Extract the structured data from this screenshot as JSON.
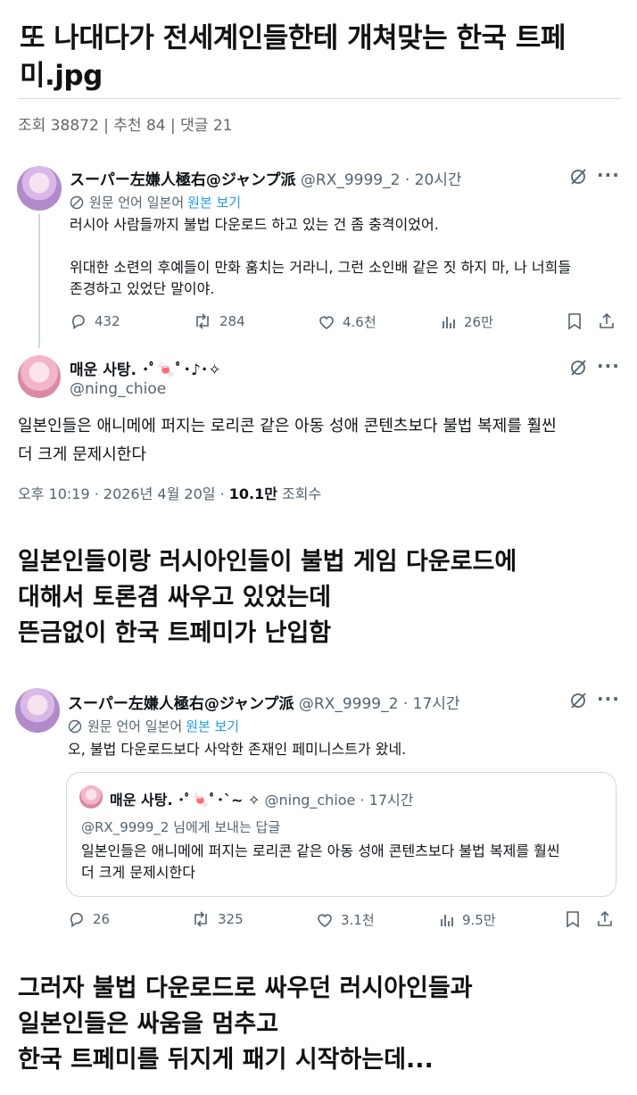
{
  "post": {
    "title": "또 나대다가 전세계인들한테 개쳐맞는 한국 트페미.jpg",
    "meta": "조회 38872 | 추천 84 | 댓글 21"
  },
  "tweet1": {
    "name": "スーパー左嫌人極右@ジャンプ派",
    "handle_time": "@RX_9999_2 · 20시간",
    "translate_label": "원문 언어 일본어",
    "translate_link": "원본 보기",
    "text": "러시아 사람들까지 불법 다운로드 하고 있는 건 좀 충격이었어.\n\n위대한 소련의 후예들이 만화 훔치는 거라니, 그런 소인배 같은 짓 하지 마, 나 너희들\n존경하고 있었단 말이야.",
    "replies": "432",
    "reposts": "284",
    "likes": "4.6천",
    "views": "26만"
  },
  "tweet2": {
    "name": "매운 사탕. ･ﾟ🍬ﾟ･♪･✧",
    "handle": "@ning_chioe",
    "text": "일본인들은 애니메에 퍼지는 로리콘 같은 아동 성애 콘텐츠보다 불법 복제를 훨씬\n더 크게 문제시한다",
    "time": "오후 10:19 · 2026년 4월 20일 · ",
    "views_count": "10.1만",
    "views_label": " 조회수"
  },
  "caption1": "일본인들이랑 러시아인들이 불법 게임 다운로드에\n대해서 토론겸 싸우고 있었는데\n뜬금없이 한국 트페미가 난입함",
  "tweet3": {
    "name": "スーパー左嫌人極右@ジャンプ派",
    "handle_time": "@RX_9999_2 · 17시간",
    "translate_label": "원문 언어 일본어",
    "translate_link": "원본 보기",
    "text": "오, 불법 다운로드보다 사악한 존재인 페미니스트가 왔네.",
    "quote": {
      "name": "매운 사탕. ･ﾟ🍬ﾟ･`~ ✧",
      "handle_time": "@ning_chioe · 17시간",
      "reply_to": "@RX_9999_2 님에게 보내는 답글",
      "text": "일본인들은 애니메에 퍼지는 로리콘 같은 아동 성애 콘텐츠보다 불법 복제를 훨씬\n더 크게 문제시한다"
    },
    "replies": "26",
    "reposts": "325",
    "likes": "3.1천",
    "views": "9.5만"
  },
  "caption2": "그러자 불법 다운로드로 싸우던 러시아인들과\n일본인들은 싸움을 멈추고\n한국 트페미를 뒤지게 패기 시작하는데...",
  "colors": {
    "link": "#1d9bf0",
    "secondary": "#536471",
    "text": "#0f1419"
  },
  "icons": [
    "reply-icon",
    "repost-icon",
    "like-icon",
    "views-icon",
    "bookmark-icon",
    "share-icon",
    "grok-icon",
    "more-icon",
    "translate-icon"
  ]
}
